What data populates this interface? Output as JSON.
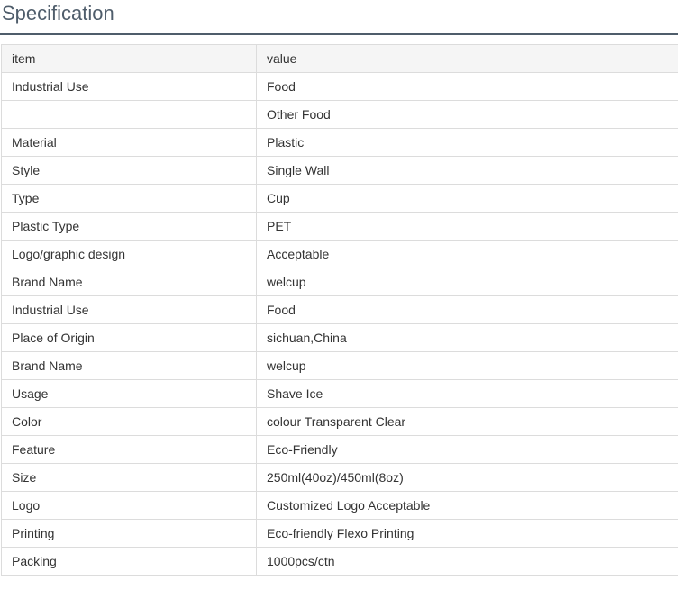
{
  "title": "Specification",
  "table": {
    "headers": [
      "item",
      "value"
    ],
    "rows": [
      [
        "Industrial Use",
        "Food"
      ],
      [
        "",
        "Other Food"
      ],
      [
        "Material",
        "Plastic"
      ],
      [
        "Style",
        "Single Wall"
      ],
      [
        "Type",
        "Cup"
      ],
      [
        "Plastic Type",
        "PET"
      ],
      [
        "Logo/graphic design",
        "Acceptable"
      ],
      [
        "Brand Name",
        "welcup"
      ],
      [
        "Industrial Use",
        "Food"
      ],
      [
        "Place of Origin",
        "sichuan,China"
      ],
      [
        "Brand Name",
        "welcup"
      ],
      [
        "Usage",
        "Shave Ice"
      ],
      [
        "Color",
        "colour Transparent Clear"
      ],
      [
        "Feature",
        "Eco-Friendly"
      ],
      [
        "Size",
        "250ml(40oz)/450ml(8oz)"
      ],
      [
        "Logo",
        "Customized Logo Acceptable"
      ],
      [
        "Printing",
        "Eco-friendly Flexo Printing"
      ],
      [
        "Packing",
        "1000pcs/ctn"
      ]
    ]
  }
}
